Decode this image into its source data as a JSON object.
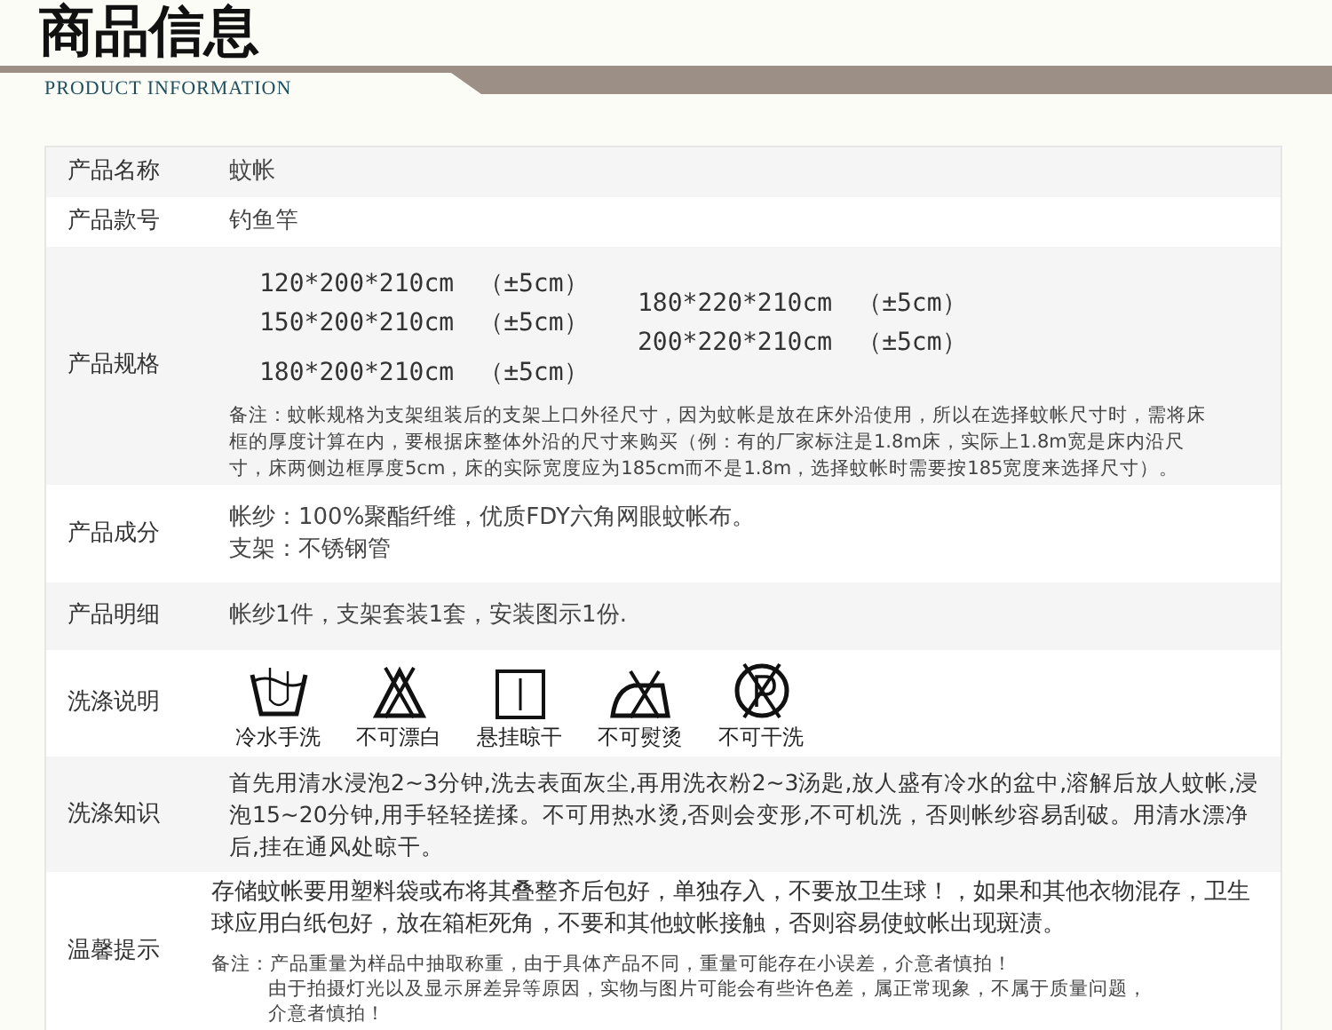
{
  "header": {
    "title": "商品信息",
    "subtitle": "PRODUCT INFORMATION"
  },
  "rows": [
    {
      "kind": "text",
      "label": "产品名称",
      "text": "蚊帐"
    },
    {
      "kind": "text",
      "label": "产品款号",
      "text": "钓鱼竿"
    },
    {
      "kind": "spec",
      "label": "产品规格",
      "left": [
        {
          "size": "120*200*210cm",
          "tolerance": "（±5cm）"
        },
        {
          "size": "150*200*210cm",
          "tolerance": "（±5cm）"
        },
        {
          "size": "180*200*210cm",
          "tolerance": "（±5cm）"
        }
      ],
      "right": [
        {
          "size": "180*220*210cm",
          "tolerance": "（±5cm）"
        },
        {
          "size": "200*220*210cm",
          "tolerance": "（±5cm）"
        }
      ],
      "note": "备注：蚊帐规格为支架组装后的支架上口外径尺寸，因为蚊帐是放在床外沿使用，所以在选择蚊帐尺寸时，需将床框的厚度计算在内，要根据床整体外沿的尺寸来购买（例：有的厂家标注是1.8m床，实际上1.8m宽是床内沿尺寸，床两侧边框厚度5cm，床的实际宽度应为185cm而不是1.8m，选择蚊帐时需要按185宽度来选择尺寸）。"
    },
    {
      "kind": "lines",
      "label": "产品成分",
      "lines": [
        "帐纱：100%聚酯纤维，优质FDY六角网眼蚊帐布。",
        "支架：不锈钢管"
      ]
    },
    {
      "kind": "text",
      "label": "产品明细",
      "text": "帐纱1件，支架套装1套，安装图示1份."
    },
    {
      "kind": "icons",
      "label": "洗涤说明",
      "items": [
        {
          "kind": "hand-wash",
          "caption": "冷水手洗"
        },
        {
          "kind": "no-bleach",
          "caption": "不可漂白"
        },
        {
          "kind": "hang-dry",
          "caption": "悬挂晾干"
        },
        {
          "kind": "no-iron",
          "caption": "不可熨烫"
        },
        {
          "kind": "no-dry-clean",
          "caption": "不可干洗"
        }
      ]
    },
    {
      "kind": "paragraph",
      "label": "洗涤知识",
      "text": "首先用清水浸泡2~3分钟,洗去表面灰尘,再用洗衣粉2~3汤匙,放人盛有冷水的盆中,溶解后放人蚊帐,浸泡15~20分钟,用手轻轻搓揉。不可用热水烫,否则会变形,不可机洗，否则帐纱容易刮破。用清水漂净后,挂在通风处晾干。"
    },
    {
      "kind": "tips",
      "label": "温馨提示",
      "text": "存储蚊帐要用塑料袋或布将其叠整齐后包好，单独存入，不要放卫生球！，如果和其他衣物混存，卫生球应用白纸包好，放在箱柜死角，不要和其他蚊帐接触，否则容易使蚊帐出现斑渍。",
      "note_lines": [
        "备注：产品重量为样品中抽取称重，由于具体产品不同，重量可能存在小误差，介意者慎拍！",
        "由于拍摄灯光以及显示屏差异等原因，实物与图片可能会有些许色差，属正常现象，不属于质量问题，",
        "介意者慎拍！"
      ]
    }
  ]
}
